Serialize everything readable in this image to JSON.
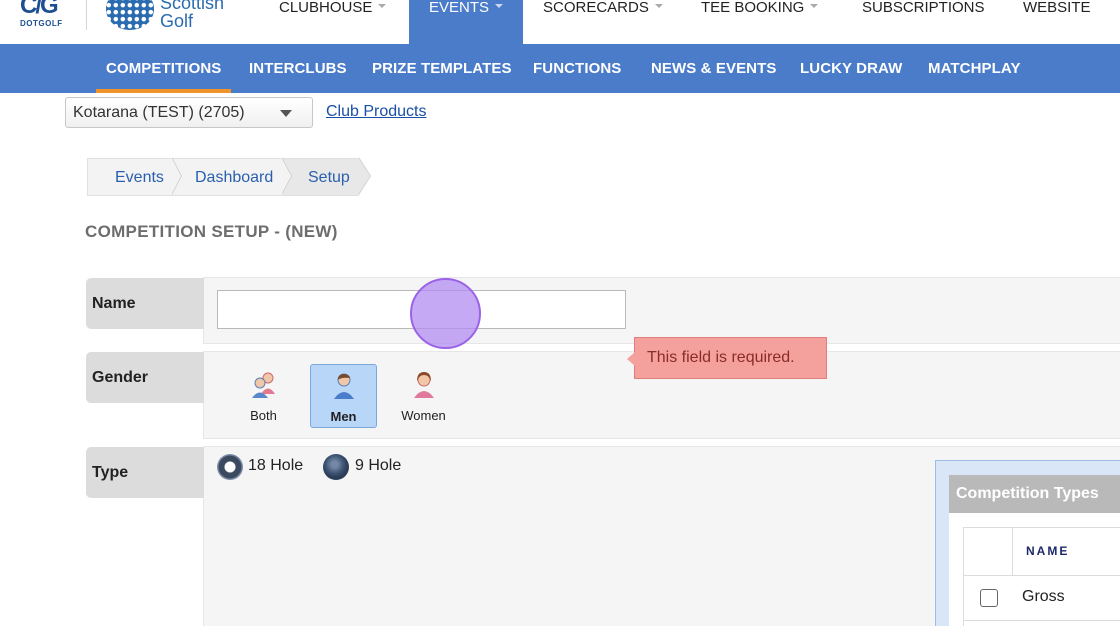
{
  "brand": {
    "dotgolf_mark": "C/G",
    "dotgolf_text": "DOTGOLF",
    "partner_line1": "Scottish",
    "partner_line2": "Golf"
  },
  "topnav": {
    "items": [
      {
        "label": "CLUBHOUSE",
        "has_menu": true,
        "active": false
      },
      {
        "label": "EVENTS",
        "has_menu": true,
        "active": true
      },
      {
        "label": "SCORECARDS",
        "has_menu": true,
        "active": false
      },
      {
        "label": "TEE BOOKING",
        "has_menu": true,
        "active": false
      },
      {
        "label": "SUBSCRIPTIONS",
        "has_menu": false,
        "active": false
      },
      {
        "label": "WEBSITE",
        "has_menu": false,
        "active": false
      }
    ]
  },
  "subnav": {
    "items": [
      {
        "label": "COMPETITIONS",
        "active": true
      },
      {
        "label": "INTERCLUBS",
        "active": false
      },
      {
        "label": "PRIZE TEMPLATES",
        "active": false
      },
      {
        "label": "FUNCTIONS",
        "active": false
      },
      {
        "label": "NEWS & EVENTS",
        "active": false
      },
      {
        "label": "LUCKY DRAW",
        "active": false
      },
      {
        "label": "MATCHPLAY",
        "active": false
      }
    ]
  },
  "club": {
    "selected": "Kotarana (TEST) (2705)",
    "products_link": "Club Products"
  },
  "breadcrumb": [
    "Events",
    "Dashboard",
    "Setup"
  ],
  "section_title": "COMPETITION SETUP - (NEW)",
  "form": {
    "name": {
      "label": "Name",
      "value": "",
      "error": "This field is required."
    },
    "gender": {
      "label": "Gender",
      "options": [
        {
          "label": "Both",
          "icon": "both-genders-icon",
          "selected": false
        },
        {
          "label": "Men",
          "icon": "man-icon",
          "selected": true
        },
        {
          "label": "Women",
          "icon": "woman-icon",
          "selected": false
        }
      ]
    },
    "type": {
      "label": "Type",
      "options": [
        {
          "label": "18 Hole",
          "selected": true
        },
        {
          "label": "9 Hole",
          "selected": false
        }
      ]
    }
  },
  "competition_types": {
    "title": "Competition Types",
    "column_name": "NAME",
    "rows": [
      {
        "name": "Gross",
        "checked": false
      }
    ]
  },
  "colors": {
    "nav_blue": "#4a7cc9",
    "active_underline": "#f0932b",
    "error_bg": "#f4a09c",
    "selected_gender": "#b8d6f7"
  }
}
